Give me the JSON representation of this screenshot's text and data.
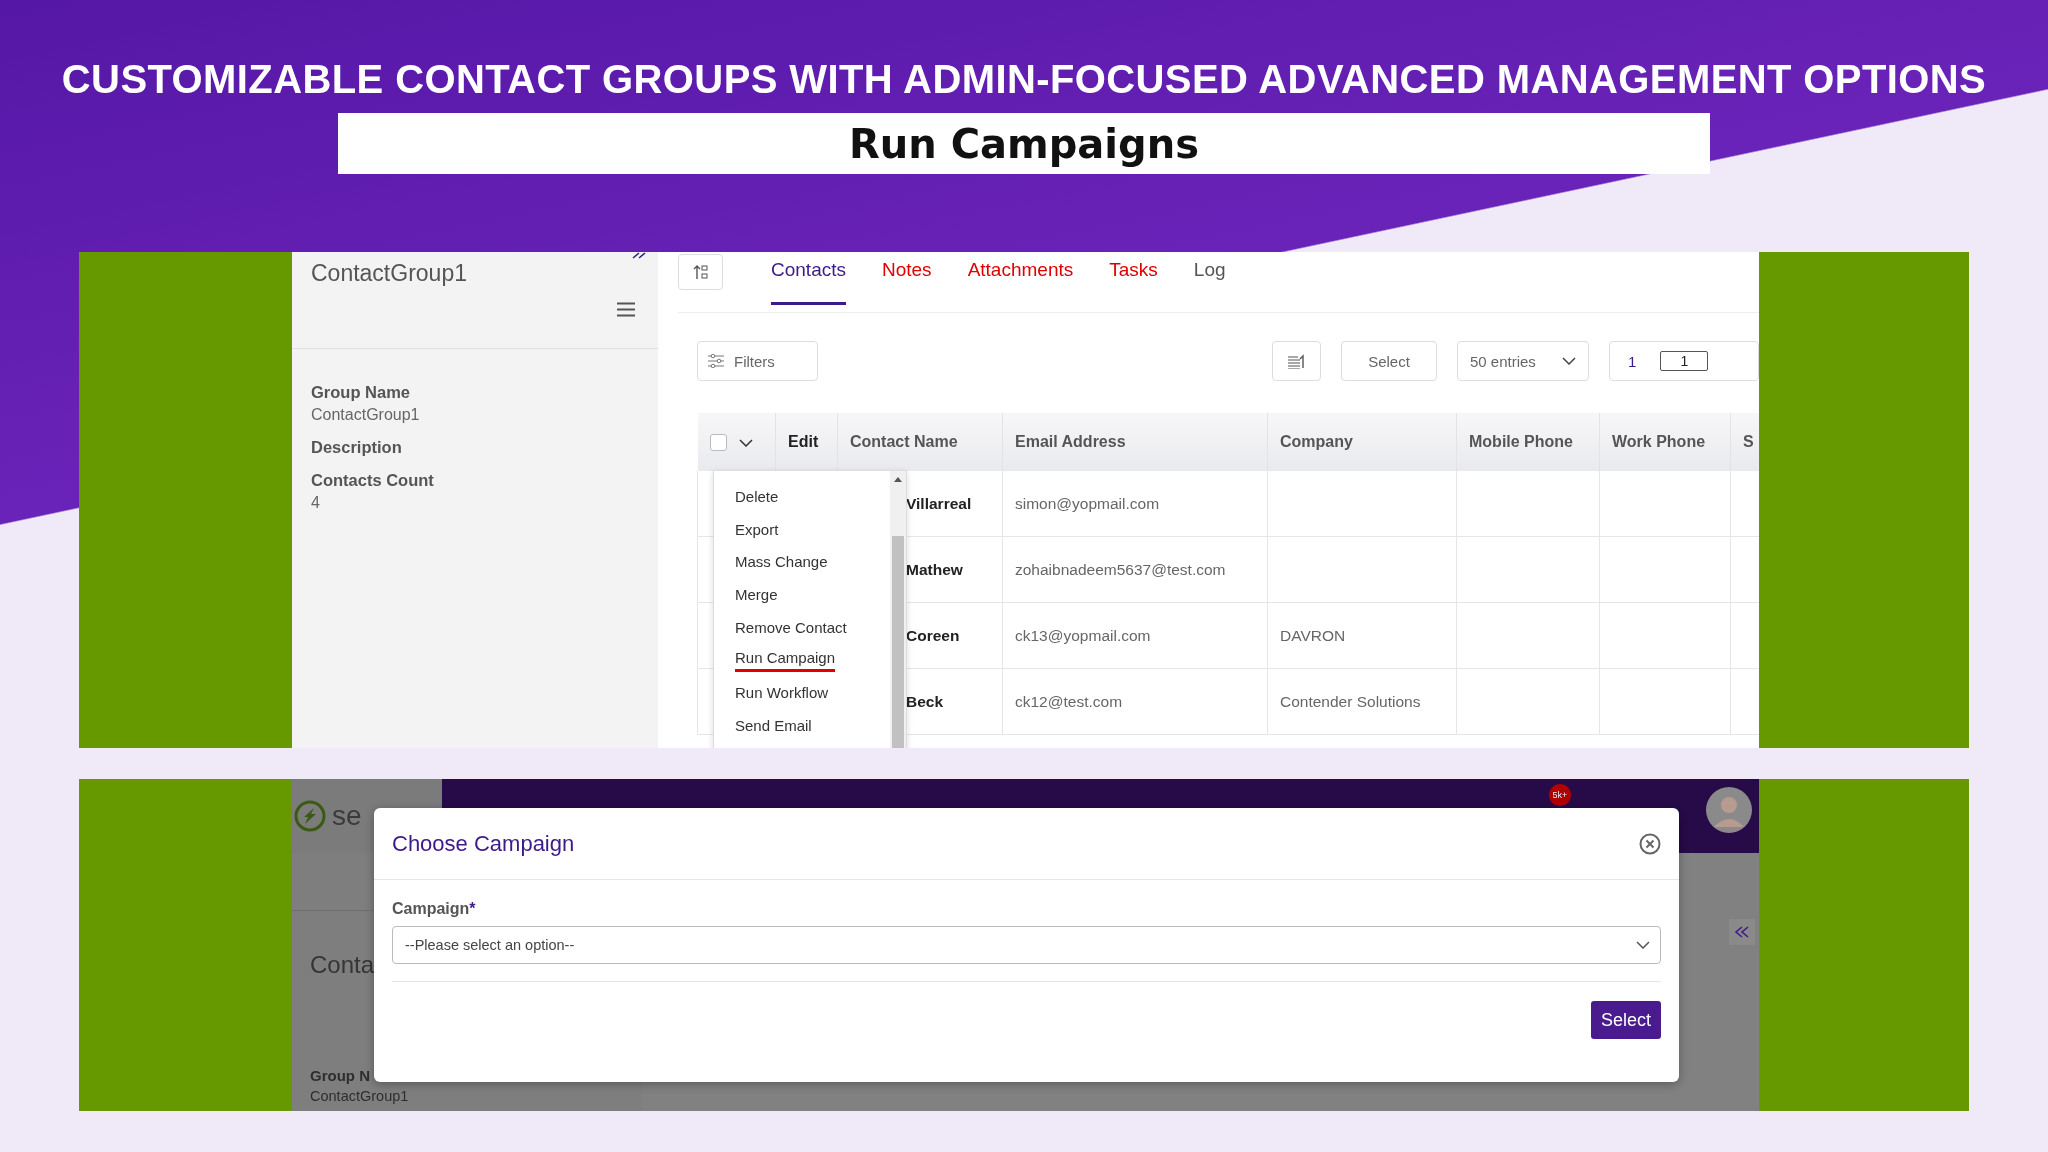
{
  "header": {
    "headline": "CUSTOMIZABLE CONTACT GROUPS WITH ADMIN-FOCUSED ADVANCED MANAGEMENT OPTIONS",
    "subtitle": "Run Campaigns"
  },
  "group_view": {
    "sidebar": {
      "title": "ContactGroup1",
      "fields": [
        {
          "label": "Group Name",
          "value": "ContactGroup1"
        },
        {
          "label": "Description"
        },
        {
          "label": "Contacts Count",
          "value": "4"
        }
      ]
    },
    "tabs": [
      {
        "label": "Contacts",
        "selected": true,
        "color": "#3d1a8a"
      },
      {
        "label": "Notes",
        "selected": false,
        "color": "#e00000"
      },
      {
        "label": "Attachments",
        "selected": false,
        "color": "#e00000"
      },
      {
        "label": "Tasks",
        "selected": false,
        "color": "#e00000"
      },
      {
        "label": "Log",
        "selected": false,
        "color": "#555555"
      }
    ],
    "toolbar": {
      "filters": "Filters",
      "select": "Select",
      "entries": "50 entries",
      "page": "1",
      "page_input": "1"
    },
    "table": {
      "select_all_checked": false,
      "columns": [
        "Edit",
        "Contact Name",
        "Email Address",
        "Company",
        "Mobile Phone",
        "Work Phone",
        "S"
      ],
      "rows": [
        {
          "contact_name": "Villarreal",
          "email": "simon@yopmail.com"
        },
        {
          "contact_name": "Mathew",
          "email": "zohaibnadeem5637@test.com"
        },
        {
          "contact_name": "Coreen",
          "email": "ck13@yopmail.com",
          "company": "DAVRON"
        },
        {
          "contact_name": "Beck",
          "email": "ck12@test.com",
          "company": "Contender Solutions"
        }
      ]
    },
    "actions_menu": {
      "items": [
        {
          "label": "Delete",
          "highlighted": false
        },
        {
          "label": "Export",
          "highlighted": false
        },
        {
          "label": "Mass Change",
          "highlighted": false
        },
        {
          "label": "Merge",
          "highlighted": false
        },
        {
          "label": "Remove Contact",
          "highlighted": false
        },
        {
          "label": "Run Campaign",
          "highlighted": true
        },
        {
          "label": "Run Workflow",
          "highlighted": false
        },
        {
          "label": "Send Email",
          "highlighted": false
        }
      ]
    }
  },
  "campaign_view": {
    "background": {
      "logo": "se",
      "badge": "5k+",
      "section_title": "Conta",
      "field_label": "Group N",
      "field_value": "ContactGroup1"
    },
    "dialog": {
      "title": "Choose Campaign",
      "field_label": "Campaign",
      "required_mark": "*",
      "placeholder": "--Please select an option--",
      "button": "Select"
    }
  }
}
